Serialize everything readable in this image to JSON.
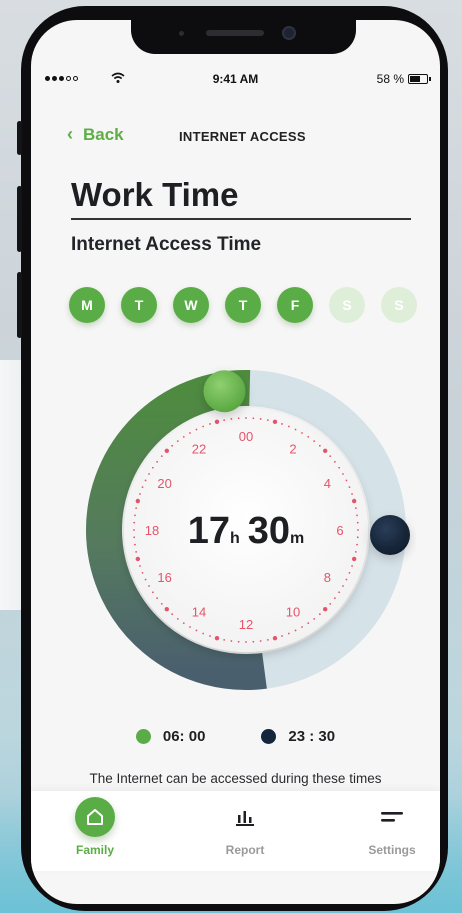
{
  "status_bar": {
    "time": "9:41 AM",
    "battery": "58 %"
  },
  "nav": {
    "back_label": "Back",
    "title": "INTERNET ACCESS"
  },
  "page": {
    "title": "Work Time",
    "subtitle": "Internet Access Time"
  },
  "days": [
    {
      "label": "M",
      "active": true
    },
    {
      "label": "T",
      "active": true
    },
    {
      "label": "W",
      "active": true
    },
    {
      "label": "T",
      "active": true
    },
    {
      "label": "F",
      "active": true
    },
    {
      "label": "S",
      "active": false
    },
    {
      "label": "S",
      "active": false
    }
  ],
  "dial": {
    "hours": "17",
    "hours_unit": "h",
    "minutes": "30",
    "minutes_unit": "m",
    "hour_labels": [
      "00",
      "2",
      "4",
      "6",
      "8",
      "10",
      "12",
      "14",
      "16",
      "18",
      "20",
      "22"
    ],
    "start_hour": 6.0,
    "end_hour": 23.5
  },
  "legend": {
    "start": "06: 00",
    "end": "23 : 30"
  },
  "note": "The Internet can be accessed during these times",
  "tabs": [
    {
      "label": "Family",
      "icon": "home-icon",
      "active": true
    },
    {
      "label": "Report",
      "icon": "bar-chart-icon",
      "active": false
    },
    {
      "label": "Settings",
      "icon": "menu-lines-icon",
      "active": false
    }
  ],
  "colors": {
    "accent": "#5aad46",
    "accent_light": "#dfeed9",
    "dark_knob": "#14263b",
    "track": "#d5e2e8",
    "tick": "#e5546a"
  }
}
